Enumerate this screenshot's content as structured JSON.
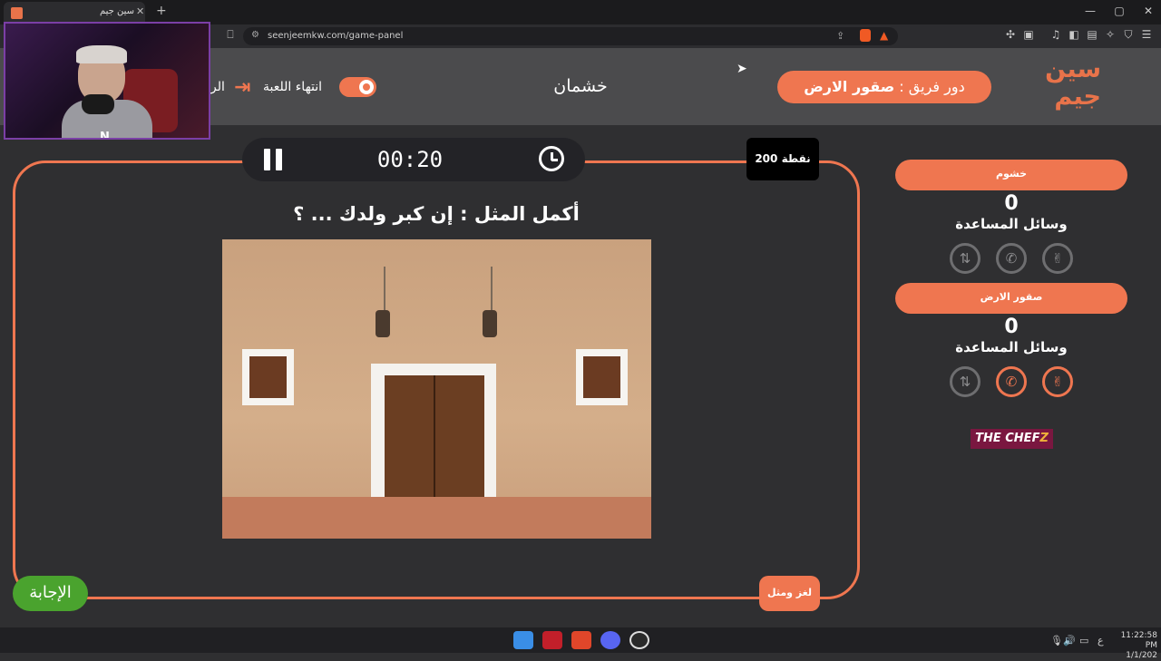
{
  "browser": {
    "tab_title": "سين جيم",
    "tab_close": "✕",
    "new_tab": "+",
    "url": "seenjeemkw.com/game-panel",
    "window_controls": [
      "—",
      "▢",
      "✕"
    ]
  },
  "webcam": {
    "overlay_logo": "N"
  },
  "header": {
    "logo_line1": "سين",
    "logo_line2": "جيم",
    "turn_prefix": "دور فريق :",
    "turn_team": "صقور الارض",
    "center_name": "خشمان",
    "end_game": "انتهاء اللعبة",
    "home_link": "الر"
  },
  "panel": {
    "timer": "00:20",
    "points": "200 نقطة",
    "question": "أكمل المثل : إن كبر ولدك ... ؟",
    "answer_button": "الإجابة",
    "category": "لغز ومثل"
  },
  "teams": [
    {
      "name": "خشوم",
      "score": "0",
      "helpers_label": "وسائل المساعدة",
      "helpers_active": [
        false,
        false,
        false
      ]
    },
    {
      "name": "صقور الارض",
      "score": "0",
      "helpers_label": "وسائل المساعدة",
      "helpers_active": [
        false,
        true,
        true
      ]
    }
  ],
  "sponsor": {
    "part1": "THE CHEF",
    "part2": "Z"
  },
  "taskbar": {
    "clock_time": "11:22:58 PM",
    "clock_date": "1/1/202",
    "lang": "ع"
  },
  "colors": {
    "accent": "#ef7650",
    "answer_green": "#4aa32e",
    "background": "#2f2f31"
  }
}
